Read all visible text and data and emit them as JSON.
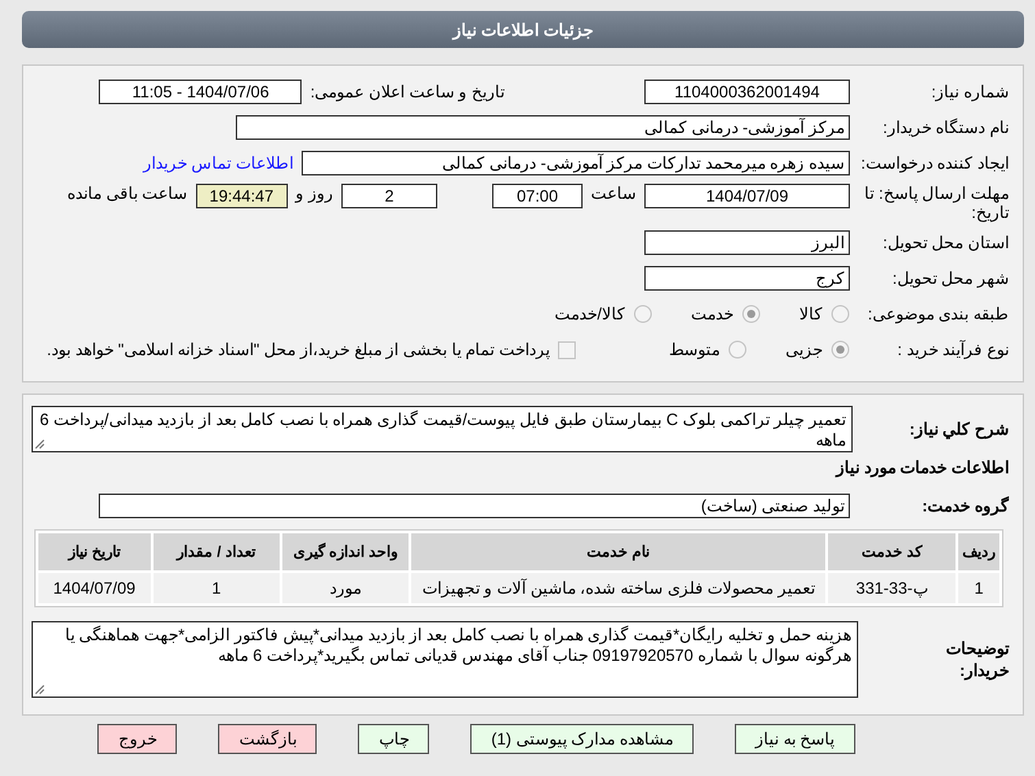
{
  "header": {
    "title": "جزئیات اطلاعات نیاز"
  },
  "details": {
    "need_number": {
      "label": "شماره نیاز:",
      "value": "1104000362001494"
    },
    "announce": {
      "label": "تاریخ و ساعت اعلان عمومی:",
      "value": "1404/07/06 - 11:05"
    },
    "buyer": {
      "label": "نام دستگاه خریدار:",
      "value": "مرکز آموزشی- درمانی کمالی"
    },
    "creator": {
      "label": "ایجاد کننده درخواست:",
      "value": "سیده زهره میرمحمد تدارکات مرکز آموزشی- درمانی کمالی",
      "link": "اطلاعات تماس خریدار"
    },
    "deadline": {
      "label": "مهلت ارسال پاسخ: تا تاریخ:",
      "date": "1404/07/09",
      "time_label": "ساعت",
      "time": "07:00",
      "days": "2",
      "days_label": "روز و",
      "remaining": "19:44:47",
      "remaining_label": "ساعت باقی مانده"
    },
    "province": {
      "label": "استان محل تحویل:",
      "value": "البرز"
    },
    "city": {
      "label": "شهر محل تحویل:",
      "value": "کرج"
    },
    "category": {
      "label": "طبقه بندی موضوعی:",
      "options": [
        {
          "label": "کالا",
          "selected": false
        },
        {
          "label": "خدمت",
          "selected": true
        },
        {
          "label": "کالا/خدمت",
          "selected": false
        }
      ]
    },
    "process": {
      "label": "نوع فرآیند خرید :",
      "options": [
        {
          "label": "جزیی",
          "selected": true
        },
        {
          "label": "متوسط",
          "selected": false
        }
      ],
      "payment": {
        "checked": false,
        "text": "پرداخت تمام یا بخشی از مبلغ خرید،از محل \"اسناد خزانه اسلامی\" خواهد بود."
      }
    }
  },
  "summary": {
    "label": "شرح کلي نياز:",
    "value": "تعمیر چیلر تراکمی بلوک C بیمارستان طبق فایل پیوست/قیمت گذاری همراه با نصب کامل بعد از بازدید میدانی/پرداخت 6 ماهه"
  },
  "services_heading": "اطلاعات خدمات مورد نیاز",
  "service_group": {
    "label": "گروه خدمت:",
    "value": "تولید صنعتی (ساخت)"
  },
  "table": {
    "columns": [
      "ردیف",
      "کد خدمت",
      "نام خدمت",
      "واحد اندازه گیری",
      "تعداد / مقدار",
      "تاریخ نیاز"
    ],
    "rows": [
      [
        "1",
        "پ-33-331",
        "تعمیر محصولات فلزی ساخته شده، ماشین آلات و تجهیزات",
        "مورد",
        "1",
        "1404/07/09"
      ]
    ]
  },
  "notes": {
    "label": "توضیحات خریدار:",
    "value": "هزینه حمل و تخلیه رایگان*قیمت گذاری همراه با نصب کامل بعد از بازدید میدانی*پیش فاکتور الزامی*جهت هماهنگی یا هرگونه سوال با شماره 09197920570 جناب آقای مهندس قدیانی تماس بگیرید*پرداخت 6 ماهه"
  },
  "buttons": [
    {
      "label": "پاسخ به نیاز",
      "kind": "normal"
    },
    {
      "label": "مشاهده مدارک پیوستی (1)",
      "kind": "normal"
    },
    {
      "label": "چاپ",
      "kind": "normal"
    },
    {
      "label": "بازگشت",
      "kind": "danger"
    },
    {
      "label": "خروج",
      "kind": "danger"
    }
  ]
}
